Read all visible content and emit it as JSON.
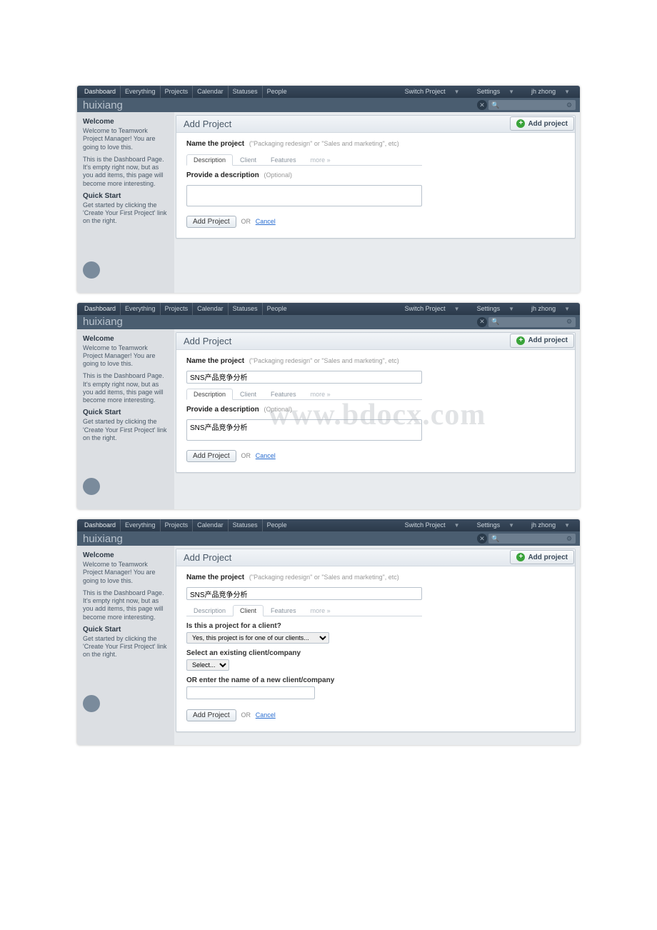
{
  "nav": {
    "items": [
      "Dashboard",
      "Everything",
      "Projects",
      "Calendar",
      "Statuses",
      "People"
    ],
    "switch_project": "Switch Project",
    "settings": "Settings",
    "user": "jh zhong"
  },
  "brand": "huixiang",
  "sidebar": {
    "welcome_h": "Welcome",
    "welcome_p": "Welcome to Teamwork Project Manager! You are going to love this.",
    "dash_p": "This is the Dashboard Page. It's empty right now, but as you add items, this page will become more interesting.",
    "quick_h": "Quick Start",
    "quick_p": "Get started by clicking the 'Create Your First Project' link on the right."
  },
  "add_project_btn": "Add project",
  "card": {
    "title": "Add Project",
    "name_label": "Name the project",
    "name_hint": "(\"Packaging redesign\" or \"Sales and marketing\", etc)",
    "tabs": {
      "description": "Description",
      "client": "Client",
      "features": "Features",
      "more": "more »"
    },
    "desc_label": "Provide a description",
    "desc_hint": "(Optional)",
    "add_btn": "Add Project",
    "or": "OR",
    "cancel": "Cancel",
    "client_q": "Is this a project for a client?",
    "client_yes": "Yes, this project is for one of our clients...",
    "select_existing": "Select an existing client/company",
    "select_ph": "Select...",
    "or_enter": "OR enter the name of a new client/company"
  },
  "values": {
    "project_name_cn": "SNS产品竞争分析",
    "desc_cn": "SNS产品竞争分析"
  },
  "watermark": "www.bdocx.com"
}
